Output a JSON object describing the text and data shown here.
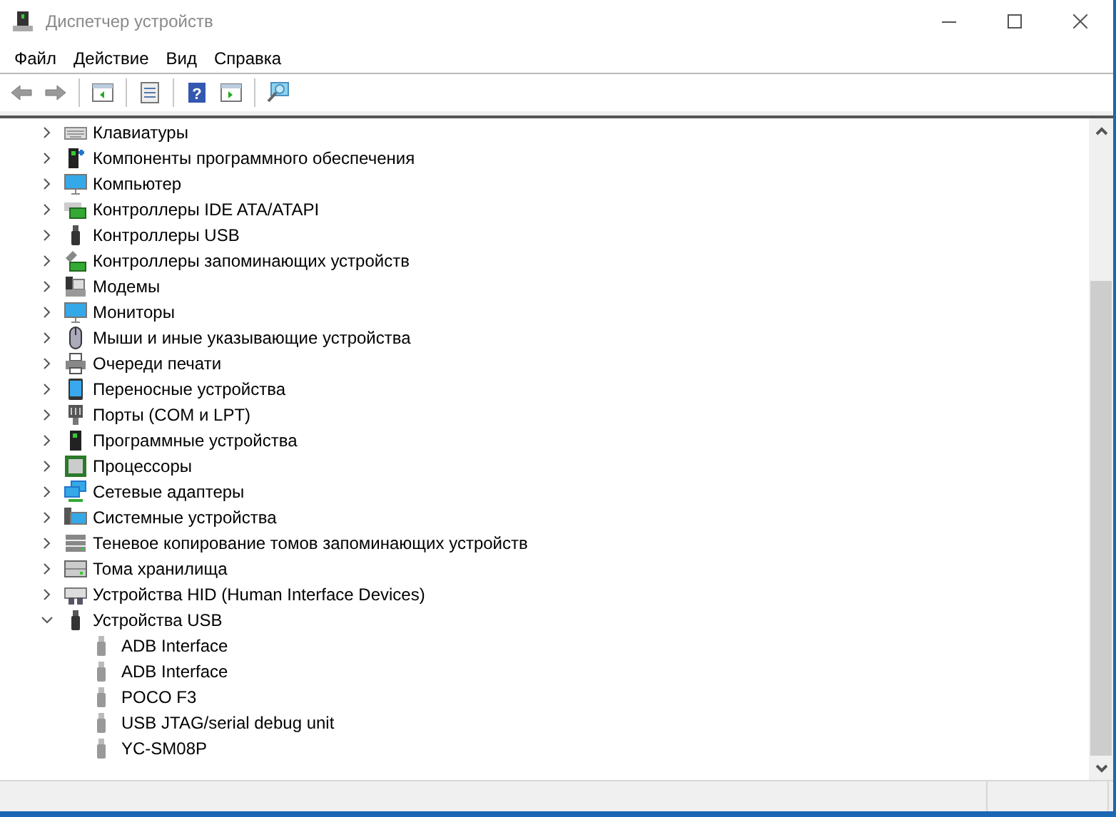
{
  "window": {
    "title": "Диспетчер устройств"
  },
  "menu": [
    "Файл",
    "Действие",
    "Вид",
    "Справка"
  ],
  "toolbar": {
    "help_glyph": "?"
  },
  "tree": [
    {
      "label": "Клавиатуры",
      "expanded": false
    },
    {
      "label": "Компоненты программного обеспечения",
      "expanded": false
    },
    {
      "label": "Компьютер",
      "expanded": false
    },
    {
      "label": "Контроллеры IDE ATA/ATAPI",
      "expanded": false
    },
    {
      "label": "Контроллеры USB",
      "expanded": false
    },
    {
      "label": "Контроллеры запоминающих устройств",
      "expanded": false
    },
    {
      "label": "Модемы",
      "expanded": false
    },
    {
      "label": "Мониторы",
      "expanded": false
    },
    {
      "label": "Мыши и иные указывающие устройства",
      "expanded": false
    },
    {
      "label": "Очереди печати",
      "expanded": false
    },
    {
      "label": "Переносные устройства",
      "expanded": false
    },
    {
      "label": "Порты (COM и LPT)",
      "expanded": false
    },
    {
      "label": "Программные устройства",
      "expanded": false
    },
    {
      "label": "Процессоры",
      "expanded": false
    },
    {
      "label": "Сетевые адаптеры",
      "expanded": false
    },
    {
      "label": "Системные устройства",
      "expanded": false
    },
    {
      "label": "Теневое копирование томов запоминающих устройств",
      "expanded": false
    },
    {
      "label": "Тома хранилища",
      "expanded": false
    },
    {
      "label": "Устройства HID (Human Interface Devices)",
      "expanded": false
    },
    {
      "label": "Устройства USB",
      "expanded": true,
      "children": [
        {
          "label": "ADB Interface"
        },
        {
          "label": "ADB Interface"
        },
        {
          "label": "POCO F3"
        },
        {
          "label": "USB JTAG/serial debug unit"
        },
        {
          "label": "YC-SM08P"
        }
      ]
    }
  ]
}
